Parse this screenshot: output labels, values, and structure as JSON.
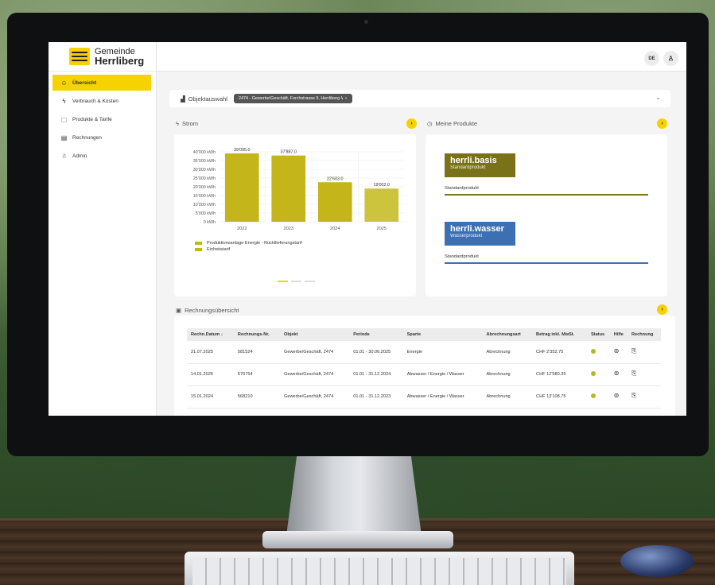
{
  "app": {
    "logo": {
      "line1": "Gemeinde",
      "line2": "Herrliberg"
    },
    "language": "DE",
    "sidebar": [
      {
        "label": "Übersicht",
        "icon": "home-icon",
        "glyph": "☺",
        "active": true
      },
      {
        "label": "Verbrauch & Kosten",
        "icon": "lightning-icon",
        "glyph": "ϟ",
        "active": false
      },
      {
        "label": "Produkte & Tarife",
        "icon": "cube-icon",
        "glyph": "⬚",
        "active": false
      },
      {
        "label": "Rechnungen",
        "icon": "invoice-icon",
        "glyph": "▤",
        "active": false
      },
      {
        "label": "Admin",
        "icon": "users-icon",
        "glyph": "☃",
        "active": false
      }
    ],
    "objekt": {
      "label": "Objektauswahl",
      "selected": "2474 - Gewerbe/Geschäft, Forchstrasse 9, Herrliberg ϟ ♁"
    },
    "strom": {
      "title": "Strom"
    },
    "produkte": {
      "title": "Meine Produkte",
      "items": [
        {
          "name": "herrli.basis",
          "sub": "Standardprodukt",
          "label": "Standardprodukt",
          "color": "#7a7218"
        },
        {
          "name": "herrli.wasser",
          "sub": "Wasserprodukt",
          "label": "Standardprodukt",
          "color": "#3c70b3"
        }
      ]
    },
    "rechnungen": {
      "title": "Rechnungsübersicht",
      "headers": [
        "Rechn.Datum ↓",
        "Rechnungs-Nr.",
        "Objekt",
        "Periode",
        "Sparte",
        "Abrechnungsart",
        "Betrag inkl. MwSt.",
        "Status",
        "Hilfe",
        "Rechnung"
      ],
      "rows": [
        [
          "21.07.2025",
          "581524",
          "Gewerbe/Geschäft, 2474",
          "01.01 - 30.06.2025",
          "Energie",
          "Abrechnung",
          "CHF 2'352.75"
        ],
        [
          "14.01.2025",
          "576754",
          "Gewerbe/Geschäft, 2474",
          "01.01 - 31.12.2024",
          "Abwasser / Energie / Wasser",
          "Abrechnung",
          "CHF 12'580.35"
        ],
        [
          "15.01.2024",
          "568210",
          "Gewerbe/Geschäft, 2474",
          "01.01 - 31.12.2023",
          "Abwasser / Energie / Wasser",
          "Abrechnung",
          "CHF 13'108.75"
        ]
      ]
    },
    "colors": {
      "accent": "#f6d200",
      "bar": "#c4b61a",
      "status_ok": "#b6b81f"
    }
  },
  "chart_data": {
    "type": "bar",
    "categories": [
      "2022",
      "2023",
      "2024",
      "2025"
    ],
    "values": [
      39095.0,
      37887.0,
      22603.0,
      19002.0
    ],
    "value_labels": [
      "39'095.0",
      "37'887.0",
      "22'603.0",
      "19'002.0"
    ],
    "ylim": [
      0,
      40000
    ],
    "y_ticks": [
      "0 kWh",
      "5'000 kWh",
      "10'000 kWh",
      "15'000 kWh",
      "20'000 kWh",
      "25'000 kWh",
      "30'000 kWh",
      "35'000 kWh",
      "40'000 kWh"
    ],
    "y_tick_values": [
      0,
      5000,
      10000,
      15000,
      20000,
      25000,
      30000,
      35000,
      40000
    ],
    "legend": [
      "Produktionsanlage Energie - Rückllieferungstarif",
      "Einheitstarif"
    ],
    "grid": true
  }
}
